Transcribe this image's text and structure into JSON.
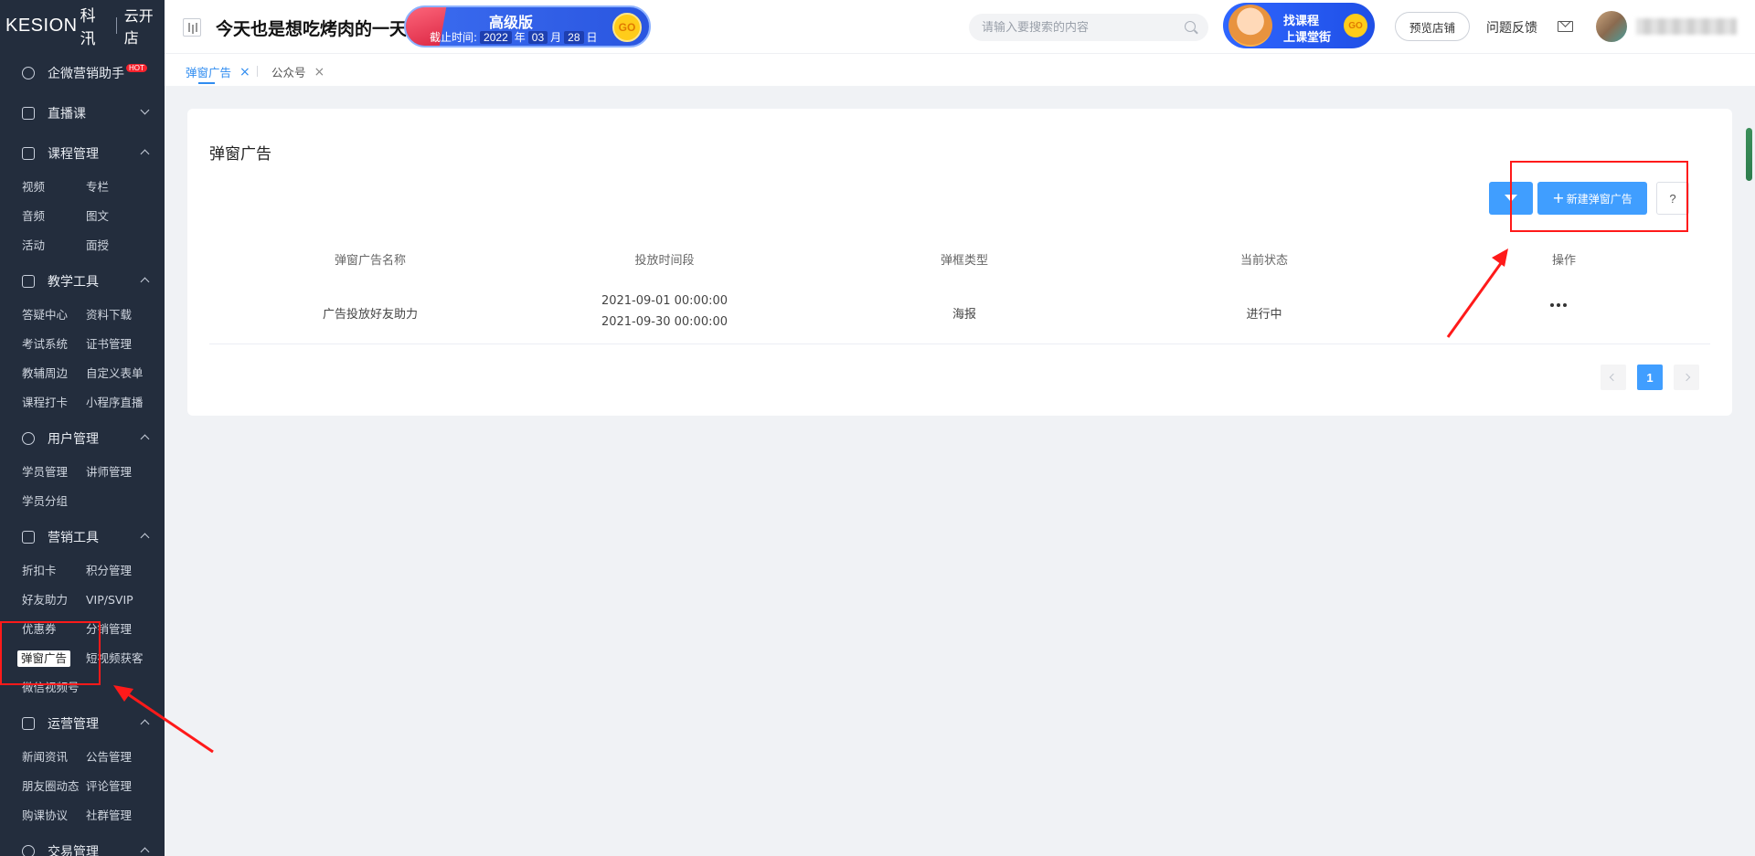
{
  "brand": {
    "logo": "KESION",
    "logo_cn": "科汛",
    "store": "云开店"
  },
  "header": {
    "slogan": "今天也是想吃烤肉的一天",
    "edition": {
      "title": "高级版",
      "expiry_label": "截止时间:",
      "year": "2022",
      "year_unit": "年",
      "month": "03",
      "month_unit": "月",
      "day": "28",
      "day_unit": "日",
      "go": "GO"
    },
    "search_placeholder": "请输入要搜索的内容",
    "promo": {
      "line1": "找课程",
      "line2": "上课堂街",
      "go": "GO"
    },
    "preview_store": "预览店铺",
    "feedback": "问题反馈"
  },
  "sidebar": {
    "promo_item": {
      "label": "企微营销助手",
      "badge": "HOT"
    },
    "sections": [
      {
        "label": "直播课",
        "icon": "live-icon",
        "expanded": false
      },
      {
        "label": "课程管理",
        "icon": "course-icon",
        "expanded": true,
        "items": [
          "视频",
          "专栏",
          "音频",
          "图文",
          "活动",
          "面授"
        ]
      },
      {
        "label": "教学工具",
        "icon": "tools-icon",
        "expanded": true,
        "items": [
          "答疑中心",
          "资料下载",
          "考试系统",
          "证书管理",
          "教辅周边",
          "自定义表单",
          "课程打卡",
          "小程序直播"
        ]
      },
      {
        "label": "用户管理",
        "icon": "user-icon",
        "expanded": true,
        "items": [
          "学员管理",
          "讲师管理",
          "学员分组"
        ]
      },
      {
        "label": "营销工具",
        "icon": "gift-icon",
        "expanded": true,
        "items": [
          "折扣卡",
          "积分管理",
          "好友助力",
          "VIP/SVIP",
          "优惠券",
          "分销管理",
          "弹窗广告",
          "短视频获客",
          "微信视频号"
        ]
      },
      {
        "label": "运营管理",
        "icon": "layers-icon",
        "expanded": true,
        "items": [
          "新闻资讯",
          "公告管理",
          "朋友圈动态",
          "评论管理",
          "购课协议",
          "社群管理"
        ]
      },
      {
        "label": "交易管理",
        "icon": "yen-icon",
        "expanded": true
      }
    ],
    "active_item": "弹窗广告"
  },
  "tabs": [
    {
      "label": "弹窗广告",
      "active": true
    },
    {
      "label": "公众号",
      "active": false
    }
  ],
  "page": {
    "title": "弹窗广告",
    "new_button": "新建弹窗广告",
    "help_button": "?",
    "columns": [
      "弹窗广告名称",
      "投放时间段",
      "弹框类型",
      "当前状态",
      "操作"
    ],
    "rows": [
      {
        "name": "广告投放好友助力",
        "start": "2021-09-01 00:00:00",
        "end": "2021-09-30 00:00:00",
        "type": "海报",
        "status": "进行中"
      }
    ],
    "pagination": {
      "current": "1"
    }
  },
  "colors": {
    "primary": "#409eff",
    "sidebar_bg": "#232d3d",
    "annotation": "#ff1a1a"
  }
}
